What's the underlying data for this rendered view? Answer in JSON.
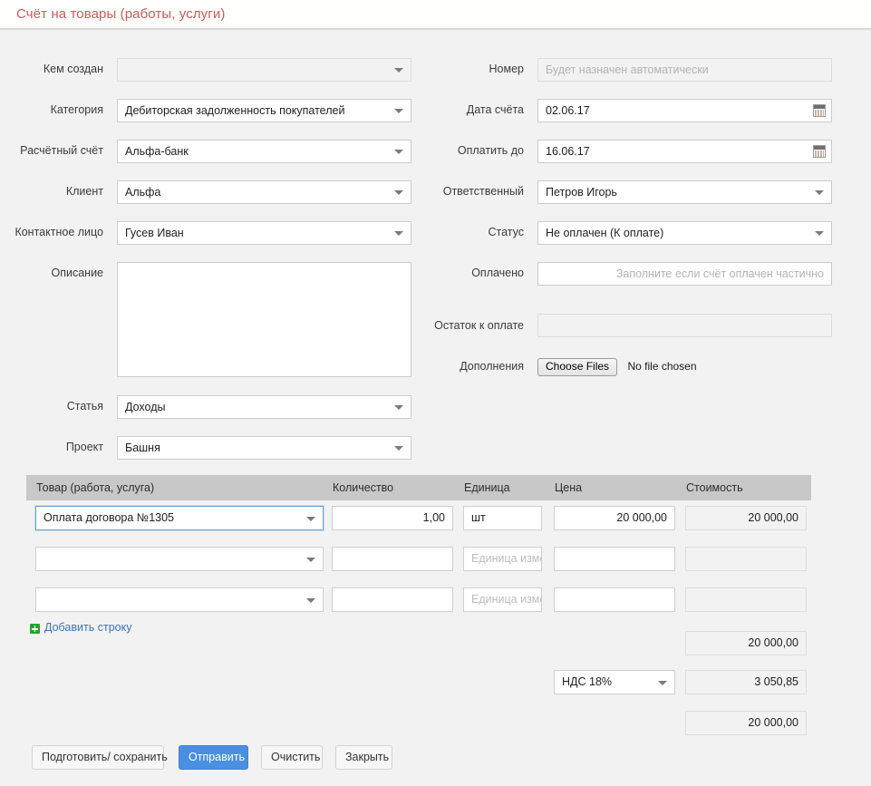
{
  "title": "Счёт на товары (работы, услуги)",
  "colors": {
    "title": "#cf5b57",
    "accent": "#4a90e2",
    "link": "#3a76bd",
    "add_badge": "#22a52c",
    "table_header_bg": "#c8c8c8",
    "page_bg": "#f2f2f2"
  },
  "left_fields": [
    {
      "label": "Кем создан",
      "value": "",
      "placeholder": "",
      "type": "select",
      "name": "created-by"
    },
    {
      "label": "Категория",
      "value": "Дебиторская задолженность покупателей",
      "placeholder": "",
      "type": "select",
      "name": "category"
    },
    {
      "label": "Расчётный счёт",
      "value": "Альфа-банк",
      "placeholder": "",
      "type": "select",
      "name": "bank-account"
    },
    {
      "label": "Клиент",
      "value": "Альфа",
      "placeholder": "",
      "type": "select",
      "name": "client"
    },
    {
      "label": "Контактное лицо",
      "value": "Гусев Иван",
      "placeholder": "",
      "type": "select",
      "name": "contact-person"
    },
    {
      "label": "Описание",
      "value": "",
      "placeholder": "",
      "type": "textarea",
      "name": "description"
    },
    {
      "label": "Статья",
      "value": "Доходы",
      "placeholder": "",
      "type": "select",
      "name": "article"
    },
    {
      "label": "Проект",
      "value": "Башня",
      "placeholder": "",
      "type": "select",
      "name": "project"
    }
  ],
  "right_fields": [
    {
      "label": "Номер",
      "value": "",
      "placeholder": "Будет назначен автоматически",
      "type": "text-readonly",
      "name": "invoice-number"
    },
    {
      "label": "Дата счёта",
      "value": "02.06.17",
      "placeholder": "",
      "type": "date",
      "name": "invoice-date"
    },
    {
      "label": "Оплатить до",
      "value": "16.06.17",
      "placeholder": "",
      "type": "date",
      "name": "due-date"
    },
    {
      "label": "Ответственный",
      "value": "Петров Игорь",
      "placeholder": "",
      "type": "select",
      "name": "responsible"
    },
    {
      "label": "Статус",
      "value": "Не оплачен (К оплате)",
      "placeholder": "",
      "type": "select",
      "name": "status"
    },
    {
      "label": "Оплачено",
      "value": "",
      "placeholder": "Заполните если счёт оплачен частично",
      "type": "text",
      "name": "paid-amount"
    },
    {
      "label": "Остаток к оплате",
      "value": "",
      "placeholder": "",
      "type": "text-readonly",
      "name": "remaining-amount"
    },
    {
      "label": "Дополнения",
      "value": "",
      "placeholder": "",
      "type": "file",
      "name": "attachments"
    }
  ],
  "file_input": {
    "button_label": "Choose Files",
    "status_text": "No file chosen"
  },
  "table": {
    "headers": [
      "Товар (работа, услуга)",
      "Количество",
      "Единица",
      "Цена",
      "Стоимость"
    ],
    "rows": [
      {
        "product": {
          "value": "Оплата договора №1305",
          "placeholder": ""
        },
        "quantity": {
          "value": "1,00",
          "placeholder": ""
        },
        "unit": {
          "value": "шт",
          "placeholder": ""
        },
        "price": {
          "value": "20 000,00",
          "placeholder": ""
        },
        "cost": {
          "value": "20 000,00",
          "placeholder": ""
        }
      },
      {
        "product": {
          "value": "",
          "placeholder": ""
        },
        "quantity": {
          "value": "",
          "placeholder": ""
        },
        "unit": {
          "value": "",
          "placeholder": "Единица изме"
        },
        "price": {
          "value": "",
          "placeholder": ""
        },
        "cost": {
          "value": "",
          "placeholder": ""
        }
      },
      {
        "product": {
          "value": "",
          "placeholder": ""
        },
        "quantity": {
          "value": "",
          "placeholder": ""
        },
        "unit": {
          "value": "",
          "placeholder": "Единица изме"
        },
        "price": {
          "value": "",
          "placeholder": ""
        },
        "cost": {
          "value": "",
          "placeholder": ""
        }
      }
    ],
    "add_row_label": "Добавить строку"
  },
  "totals": {
    "subtotal": "20 000,00",
    "vat_option": "НДС 18%",
    "vat_amount": "3 050,85",
    "grand_total": "20 000,00"
  },
  "buttons": [
    {
      "label": "Подготовить/ сохранить",
      "style": "default",
      "name": "prepare-save-button"
    },
    {
      "label": "Отправить",
      "style": "primary",
      "name": "send-button"
    },
    {
      "label": "Очистить",
      "style": "default",
      "name": "clear-button"
    },
    {
      "label": "Закрыть",
      "style": "default",
      "name": "close-button"
    }
  ]
}
